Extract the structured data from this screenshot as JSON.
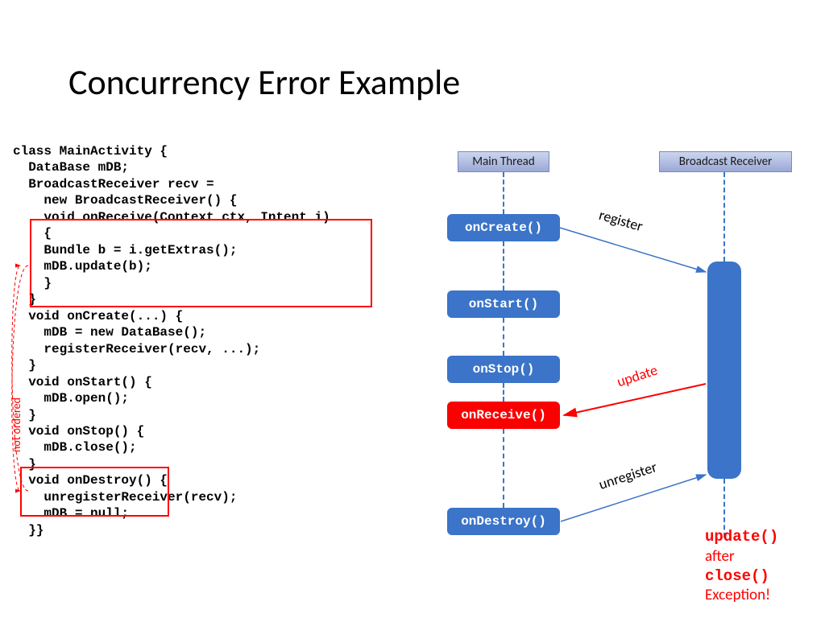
{
  "title": "Concurrency Error Example",
  "code": "class MainActivity {\n  DataBase mDB;\n  BroadcastReceiver recv =\n    new BroadcastReceiver() {\n    void onReceive(Context ctx, Intent i)\n    {\n    Bundle b = i.getExtras();\n    mDB.update(b);\n    }\n  }\n  void onCreate(...) {\n    mDB = new DataBase();\n    registerReceiver(recv, ...);\n  }\n  void onStart() {\n    mDB.open();\n  }\n  void onStop() {\n    mDB.close();\n  }\n  void onDestroy() {\n    unregisterReceiver(recv);\n    mDB = null;\n  }}",
  "headers": {
    "main": "Main Thread",
    "receiver": "Broadcast Receiver"
  },
  "boxes": {
    "onCreate": "onCreate()",
    "onStart": "onStart()",
    "onStop": "onStop()",
    "onReceive": "onReceive()",
    "onDestroy": "onDestroy()"
  },
  "labels": {
    "register": "register",
    "update": "update",
    "unregister": "unregister",
    "not_ordered": "not ordered"
  },
  "error": {
    "l1": "update()",
    "l2": "after",
    "l3": "close()",
    "l4": "Exception!"
  }
}
